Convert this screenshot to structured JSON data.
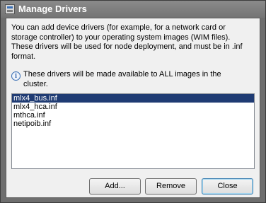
{
  "window": {
    "title": "Manage Drivers"
  },
  "description": {
    "line1": "You can add device drivers (for example, for a network card or",
    "line2": "storage controller) to your operating system images (WIM files).",
    "line3": "These drivers will be used for node deployment, and must be in .inf",
    "line4": "format."
  },
  "info": {
    "icon": "info-icon",
    "line1": "These drivers will be made available to ALL images in the",
    "line2": "cluster."
  },
  "drivers": {
    "items": [
      {
        "label": "mlx4_bus.inf",
        "selected": true
      },
      {
        "label": "mlx4_hca.inf",
        "selected": false
      },
      {
        "label": "mthca.inf",
        "selected": false
      },
      {
        "label": "netipoib.inf",
        "selected": false
      }
    ]
  },
  "buttons": {
    "add": "Add...",
    "remove": "Remove",
    "close": "Close"
  },
  "colors": {
    "selection": "#1f3b73",
    "titlebar": "#7e7e7e",
    "dialog_bg": "#f0f0f0"
  }
}
